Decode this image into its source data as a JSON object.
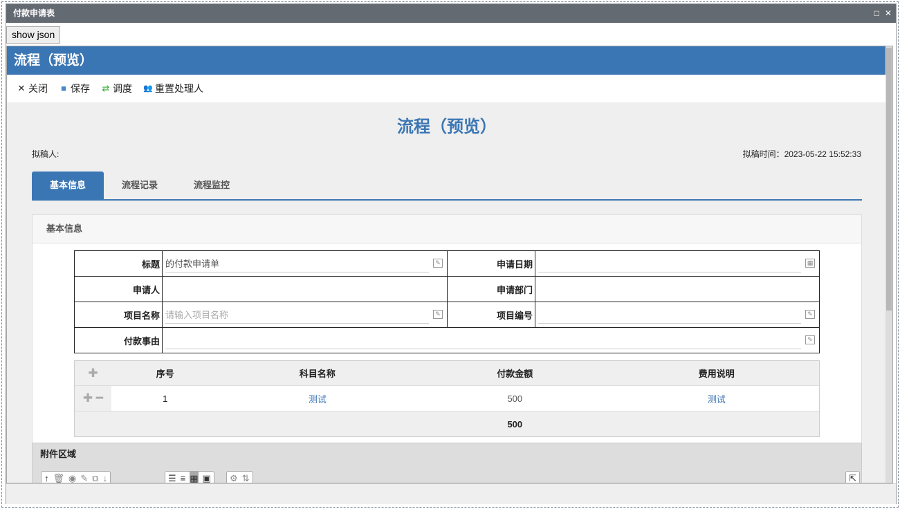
{
  "window": {
    "title": "付款申请表",
    "maximize_icon": "□",
    "close_icon": "✕"
  },
  "show_json_label": "show json",
  "header": {
    "title": "流程（预览）"
  },
  "toolbar": [
    {
      "label": "关闭",
      "icon": "✕"
    },
    {
      "label": "保存",
      "icon": "■"
    },
    {
      "label": "调度",
      "icon": "⇄"
    },
    {
      "label": "重置处理人",
      "icon": "👥"
    }
  ],
  "page": {
    "title": "流程（预览）",
    "drafter_label": "拟稿人:",
    "draft_time": "拟稿时间：2023-05-22 15:52:33"
  },
  "tabs": [
    "基本信息",
    "流程记录",
    "流程监控"
  ],
  "panel": {
    "title": "基本信息"
  },
  "form": {
    "title_label": "标题",
    "title_value": "的付款申请单",
    "date_label": "申请日期",
    "date_value": "",
    "applicant_label": "申请人",
    "applicant_value": "",
    "dept_label": "申请部门",
    "dept_value": "",
    "project_name_label": "项目名称",
    "project_name_placeholder": "请输入项目名称",
    "project_no_label": "项目编号",
    "project_no_value": "",
    "reason_label": "付款事由",
    "reason_value": ""
  },
  "detail": {
    "columns": [
      "序号",
      "科目名称",
      "付款金额",
      "费用说明"
    ],
    "rows": [
      {
        "no": "1",
        "subject": "测试",
        "amount": "500",
        "desc": "测试"
      }
    ],
    "total": "500"
  },
  "attachments": {
    "title": "附件区域"
  }
}
